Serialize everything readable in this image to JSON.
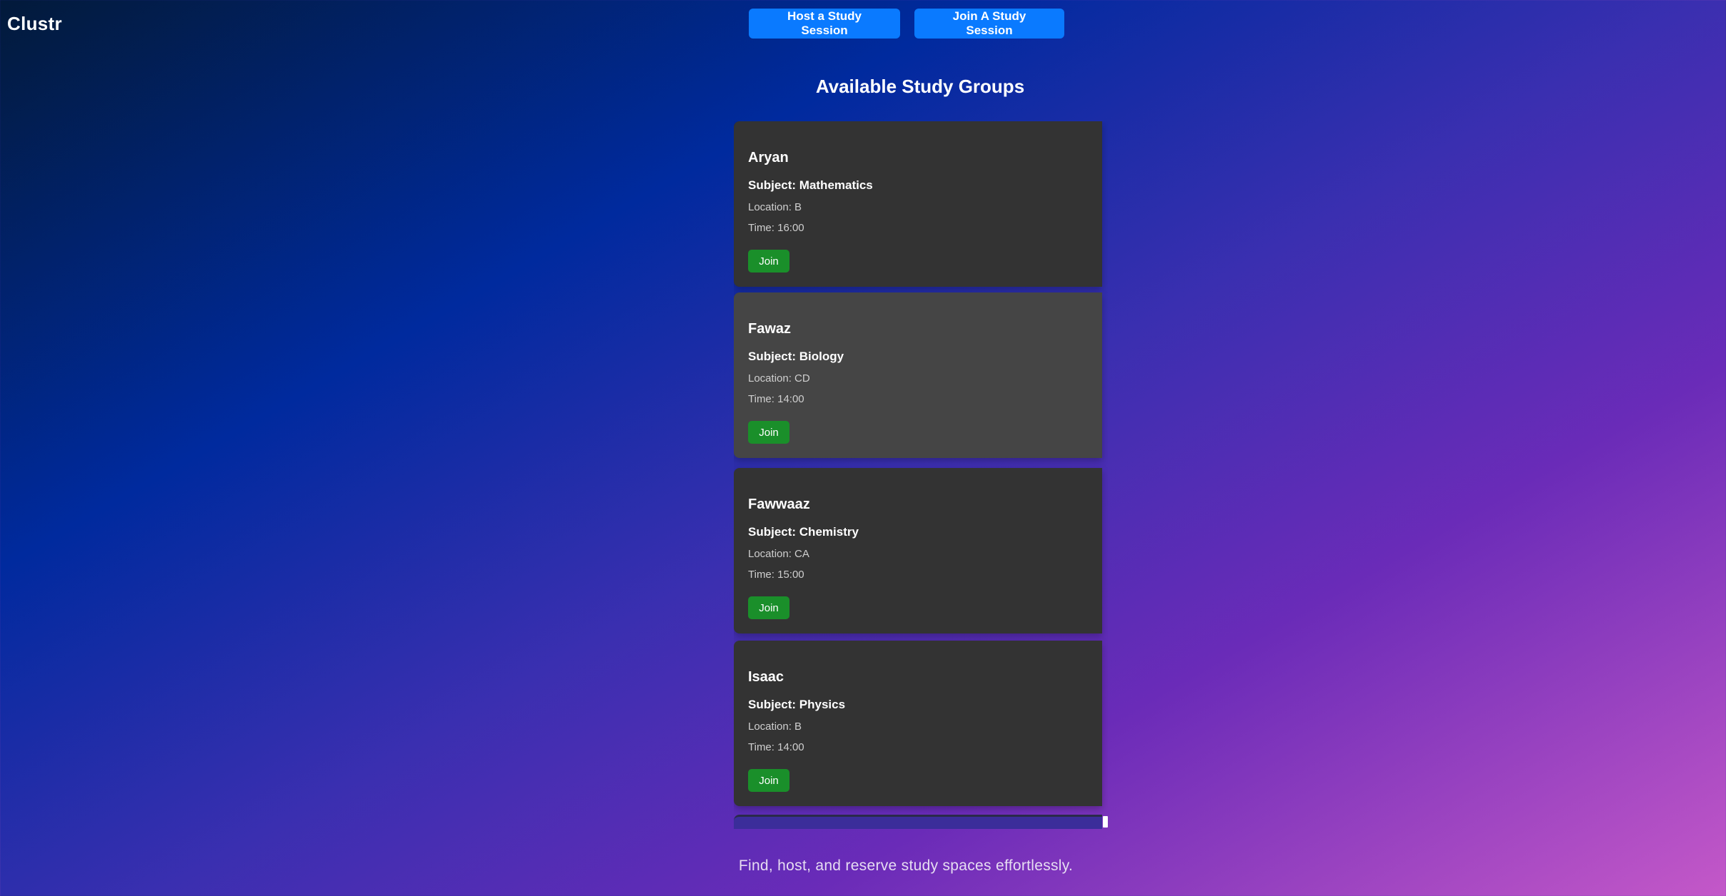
{
  "app": {
    "logo": "Clustr"
  },
  "nav": {
    "host_label": "Host a Study Session",
    "join_label": "Join A Study Session"
  },
  "main": {
    "title": "Available Study Groups",
    "groups": [
      {
        "host": "Aryan",
        "subject": "Subject: Mathematics",
        "location": "Location: B",
        "time": "Time: 16:00",
        "join_label": "Join"
      },
      {
        "host": "Fawaz",
        "subject": "Subject: Biology",
        "location": "Location: CD",
        "time": "Time: 14:00",
        "join_label": "Join"
      },
      {
        "host": "Fawwaaz",
        "subject": "Subject: Chemistry",
        "location": "Location: CA",
        "time": "Time: 15:00",
        "join_label": "Join"
      },
      {
        "host": "Isaac",
        "subject": "Subject: Physics",
        "location": "Location: B",
        "time": "Time: 14:00",
        "join_label": "Join"
      }
    ]
  },
  "footer": {
    "tagline": "Find, host, and reserve study spaces effortlessly."
  },
  "colors": {
    "primary_button": "#0a7aff",
    "join_button": "#1a8f2a",
    "card_background": "#333333"
  }
}
